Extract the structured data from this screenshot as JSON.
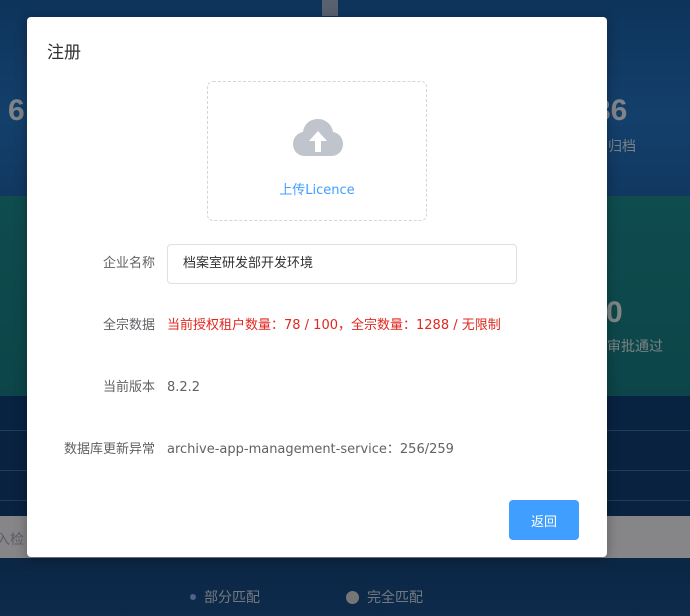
{
  "background": {
    "stats": [
      {
        "value": "6",
        "label": ""
      },
      {
        "value": "36",
        "label": "归档"
      },
      {
        "value": "0",
        "label": "审批通过"
      }
    ],
    "search_placeholder": "入检",
    "radios": [
      {
        "label": "部分匹配",
        "selected": false
      },
      {
        "label": "完全匹配",
        "selected": false
      }
    ]
  },
  "modal": {
    "title": "注册",
    "upload": {
      "icon": "cloud-upload-icon",
      "label": "上传Licence"
    },
    "fields": {
      "company_label": "企业名称",
      "company_value": "档案室研发部开发环境",
      "data_label": "全宗数据",
      "data_value": "当前授权租户数量：78 / 100，全宗数量：1288 / 无限制",
      "version_label": "当前版本",
      "version_value": "8.2.2",
      "db_label": "数据库更新异常",
      "db_value": "archive-app-management-service：256/259"
    },
    "back_label": "返回"
  },
  "colors": {
    "primary": "#409eff",
    "warning_text": "#e0281f",
    "upload_icon": "#c0c4cc"
  }
}
